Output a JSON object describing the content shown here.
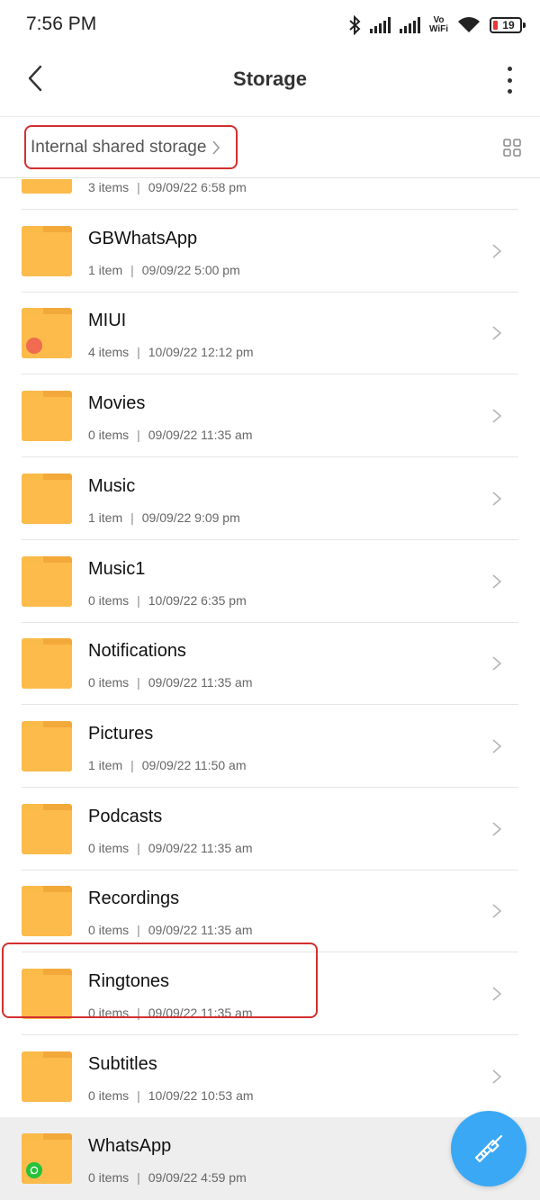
{
  "status_bar": {
    "time": "7:56 PM",
    "network_label_top": "Vo",
    "network_label_bottom": "WiFi",
    "battery_level": "19",
    "icons": [
      "bluetooth-icon",
      "signal-icon",
      "signal-icon",
      "vowifi-icon",
      "wifi-icon",
      "battery-icon"
    ]
  },
  "app_bar": {
    "title": "Storage",
    "back_icon": "chevron-left-icon",
    "menu_icon": "more-vertical-icon"
  },
  "path_bar": {
    "breadcrumb": "Internal shared storage",
    "view_toggle_icon": "grid-view-icon"
  },
  "folders": [
    {
      "name": "",
      "count": "3 items",
      "date": "09/09/22 6:58 pm",
      "badge": null
    },
    {
      "name": "GBWhatsApp",
      "count": "1 item",
      "date": "09/09/22 5:00 pm",
      "badge": null
    },
    {
      "name": "MIUI",
      "count": "4 items",
      "date": "10/09/22 12:12 pm",
      "badge": "miui"
    },
    {
      "name": "Movies",
      "count": "0 items",
      "date": "09/09/22 11:35 am",
      "badge": null
    },
    {
      "name": "Music",
      "count": "1 item",
      "date": "09/09/22 9:09 pm",
      "badge": null
    },
    {
      "name": "Music1",
      "count": "0 items",
      "date": "10/09/22 6:35 pm",
      "badge": null
    },
    {
      "name": "Notifications",
      "count": "0 items",
      "date": "09/09/22 11:35 am",
      "badge": null
    },
    {
      "name": "Pictures",
      "count": "1 item",
      "date": "09/09/22 11:50 am",
      "badge": null
    },
    {
      "name": "Podcasts",
      "count": "0 items",
      "date": "09/09/22 11:35 am",
      "badge": null
    },
    {
      "name": "Recordings",
      "count": "0 items",
      "date": "09/09/22 11:35 am",
      "badge": null
    },
    {
      "name": "Ringtones",
      "count": "0 items",
      "date": "09/09/22 11:35 am",
      "badge": null
    },
    {
      "name": "Subtitles",
      "count": "0 items",
      "date": "10/09/22 10:53 am",
      "badge": null
    },
    {
      "name": "WhatsApp",
      "count": "0 items",
      "date": "09/09/22 4:59 pm",
      "badge": "whatsapp",
      "selected": true
    }
  ],
  "colors": {
    "folder": "#fcbb4b",
    "fab": "#3aa8f4",
    "highlight_outline": "#d32f2f",
    "miui_badge": "#f06b4f",
    "whatsapp_badge": "#25c23a"
  },
  "fab": {
    "icon": "broom-icon"
  }
}
